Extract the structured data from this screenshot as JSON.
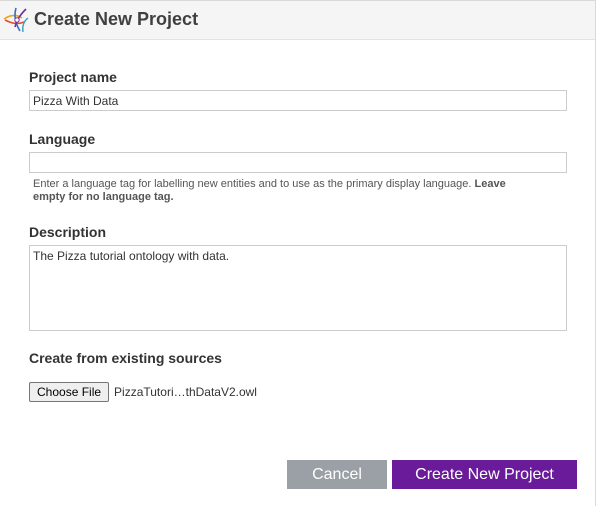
{
  "dialog": {
    "title": "Create New Project",
    "logo_icon": "webprotege-logo-icon"
  },
  "form": {
    "project_name": {
      "label": "Project name",
      "value": "Pizza With Data"
    },
    "language": {
      "label": "Language",
      "value": "",
      "hint_text": "Enter a language tag for labelling new entities and to use as the primary display language.",
      "hint_bold": "Leave empty for no language tag."
    },
    "description": {
      "label": "Description",
      "value": "The Pizza tutorial ontology with data."
    },
    "sources": {
      "label": "Create from existing sources",
      "choose_file_label": "Choose File",
      "file_name": "PizzaTutori…thDataV2.owl"
    }
  },
  "buttons": {
    "cancel_label": "Cancel",
    "create_label": "Create New Project"
  },
  "colors": {
    "cancel_bg": "#9aa0a6",
    "create_bg": "#6a1b9a",
    "titlebar_bg": "#f5f5f5"
  }
}
